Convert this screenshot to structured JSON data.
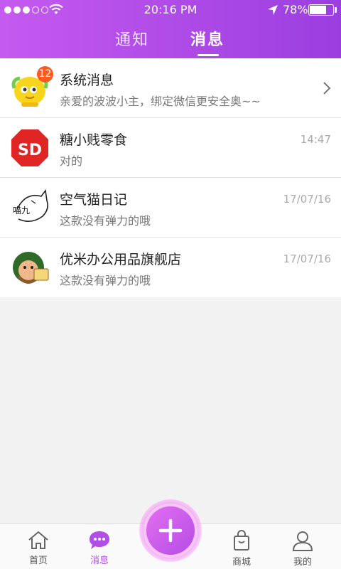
{
  "status_bar": {
    "time": "20:16 PM",
    "battery_percent": "78%",
    "battery_level": 0.78
  },
  "header": {
    "tabs": [
      {
        "label": "通知",
        "active": false
      },
      {
        "label": "消息",
        "active": true
      }
    ]
  },
  "messages": [
    {
      "name": "系统消息",
      "preview": "亲爱的波波小主，绑定微信更安全奥~~",
      "time": "",
      "badge": "12",
      "avatar": "yellow-mascot-avatar"
    },
    {
      "name": "糖小贱零食",
      "preview": "对的",
      "time": "14:47",
      "avatar": "sd-logo-avatar"
    },
    {
      "name": "空气猫日记",
      "preview": "这款没有弹力的哦",
      "time": "17/07/16",
      "avatar": "cat-sketch-avatar"
    },
    {
      "name": "优米办公用品旗舰店",
      "preview": "这款没有弹力的哦",
      "time": "17/07/16",
      "avatar": "cartoon-character-avatar"
    }
  ],
  "tab_bar": {
    "items": [
      {
        "label": "首页",
        "icon": "home-icon",
        "active": false
      },
      {
        "label": "消息",
        "icon": "chat-bubble-icon",
        "active": true
      },
      {
        "label": "商城",
        "icon": "shopping-bag-icon",
        "active": false
      },
      {
        "label": "我的",
        "icon": "user-icon",
        "active": false
      }
    ],
    "fab_icon": "plus-icon"
  },
  "colors": {
    "accent": "#b24de8",
    "badge": "#ff5a1f"
  }
}
